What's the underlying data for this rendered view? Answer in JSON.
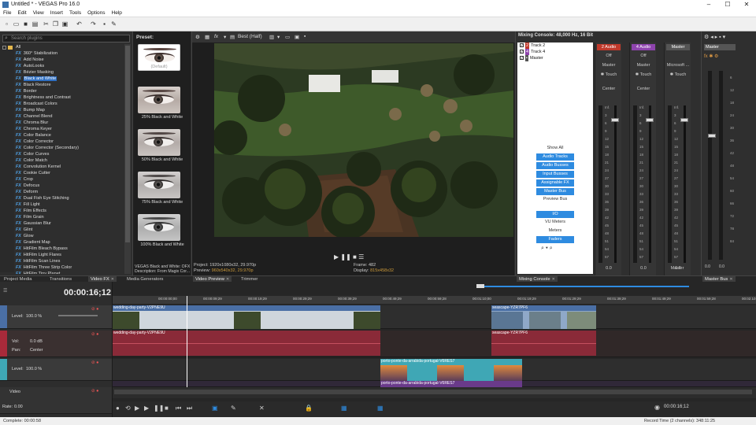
{
  "title": "Untitled * - VEGAS Pro 16.0",
  "menu": [
    "File",
    "Edit",
    "View",
    "Insert",
    "Tools",
    "Options",
    "Help"
  ],
  "fx": {
    "search_placeholder": "Search plugins",
    "root": "All",
    "items": [
      "360° Stabilization",
      "Add Noise",
      "AutoLooks",
      "Bézier Masking",
      "Black and White",
      "Black Restore",
      "Border",
      "Brightness and Contrast",
      "Broadcast Colors",
      "Bump Map",
      "Channel Blend",
      "Chroma Blur",
      "Chroma Keyer",
      "Color Balance",
      "Color Corrector",
      "Color Corrector (Secondary)",
      "Color Curves",
      "Color Match",
      "Convolution Kernel",
      "Cookie Cutter",
      "Crop",
      "Defocus",
      "Deform",
      "Dual Fish Eye Stitching",
      "Fill Light",
      "Film Effects",
      "Film Grain",
      "Gaussian Blur",
      "Glint",
      "Glow",
      "Gradient Map",
      "HitFilm Bleach Bypass",
      "HitFilm Light Flares",
      "HitFilm Scan Lines",
      "HitFilm Three Strip Color",
      "HitFilm Tiny Planet"
    ],
    "fx_tag": "FX",
    "selected_index": 4
  },
  "presets": {
    "header": "Preset:",
    "items": [
      "(Default)",
      "25% Black and White",
      "50% Black and White",
      "75% Black and White",
      "100% Black and White"
    ],
    "desc1": "VEGAS Black and White: OFX",
    "desc2": "Description: From Magix Cor..."
  },
  "left_tabs": [
    "Project Media",
    "Transitions",
    "Video FX",
    "Media Generators"
  ],
  "preview": {
    "quality": "Best (Half)",
    "project": "Project:",
    "project_val": "1920x1080x32, 29.970p",
    "preview": "Preview:",
    "preview_val": "960x540x32, 29.970p",
    "frame": "Frame:",
    "frame_val": "482",
    "display": "Display:",
    "display_val": "815x458x32",
    "tabs": [
      "Video Preview",
      "Trimmer"
    ]
  },
  "mixer": {
    "header": "Mixing Console: 48,000 Hz, 16 Bit",
    "tracks": [
      {
        "num": "2",
        "name": "Track 2",
        "color": "#c0392b"
      },
      {
        "num": "4",
        "name": "Track 4",
        "color": "#8e44ad"
      },
      {
        "num": "",
        "name": "Master",
        "color": "#555"
      }
    ],
    "show_all": "Show All",
    "buttons": [
      "Audio Tracks",
      "Audio Busses",
      "Input Busses",
      "Assignable FX",
      "Master Bus"
    ],
    "preview_bus": "Preview Bus",
    "io": "I/O",
    "vu": "VU Meters",
    "meters": "Meters",
    "faders": "Faders",
    "strips": [
      {
        "name": "2 Audio",
        "color": "#c0392b",
        "state": "Off",
        "route": "Master",
        "touch": "Touch",
        "pan": "Center",
        "level": "0.0"
      },
      {
        "name": "4 Audio",
        "color": "#8e44ad",
        "state": "Off",
        "route": "Master",
        "touch": "Touch",
        "pan": "Center",
        "level": "0.0"
      },
      {
        "name": "Master",
        "color": "#555",
        "state": "",
        "route": "Microsoft ...",
        "touch": "Touch",
        "pan": "",
        "level": "0.0"
      }
    ],
    "master_label": "Master",
    "tab": "Mixing Console",
    "scale": [
      "Inf.",
      "3",
      "6",
      "9",
      "12",
      "15",
      "18",
      "21",
      "24",
      "27",
      "30",
      "33",
      "36",
      "39",
      "42",
      "45",
      "48",
      "51",
      "54",
      "57"
    ]
  },
  "master_bus": {
    "name": "Master",
    "tab": "Master Bus",
    "level_l": "0.0",
    "level_r": "0.0",
    "scale": [
      "6",
      "12",
      "18",
      "24",
      "30",
      "36",
      "42",
      "48",
      "54",
      "60",
      "66",
      "72",
      "78",
      "84"
    ]
  },
  "timeline": {
    "timecode": "00:00:16;12",
    "ruler": [
      "00:00:00;00",
      "00:00:09;29",
      "00:00:19;29",
      "00:00:29;29",
      "00:00:39;29",
      "00:00:49;29",
      "00:00:59;28",
      "00:01:10;00",
      "00:01:19;29",
      "00:01:29;29",
      "00:01:39;29",
      "00:01:49;29",
      "00:01:59;28",
      "00:02:10;00"
    ],
    "tracks": [
      {
        "type": "video",
        "level_label": "Level:",
        "level": "100.0 %"
      },
      {
        "type": "audio",
        "vol_label": "Vol:",
        "vol": "0.0 dB",
        "pan_label": "Pan:",
        "pan": "Center"
      },
      {
        "type": "video",
        "level_label": "Level:",
        "level": "100.0 %"
      },
      {
        "type": "bus",
        "name": "Video",
        "rate_label": "Rate:",
        "rate": "0.00"
      }
    ],
    "clips": {
      "v1a": "wedding-day-party-V2PNE9U",
      "a1a": "wedding-day-party-V2PNE9U",
      "v1b": "seascape-YZR7PF6",
      "a1b": "seascape-YZR7PF6",
      "v2": "porto-ponte-da-arrabida-portugal-V6RES7",
      "a2": "porto-ponte-da-arrabida-portugal-V6RES7"
    },
    "end_time": "00:00:16;12"
  },
  "status": {
    "left": "Complete: 00:00:58",
    "right": "Record Time (2 channels): 348:11:25"
  },
  "colors": {
    "accent": "#2e8be0",
    "video_clip": "#4a6fa5",
    "audio_clip": "#8a2a38",
    "porto_clip": "#3fa7b5"
  }
}
